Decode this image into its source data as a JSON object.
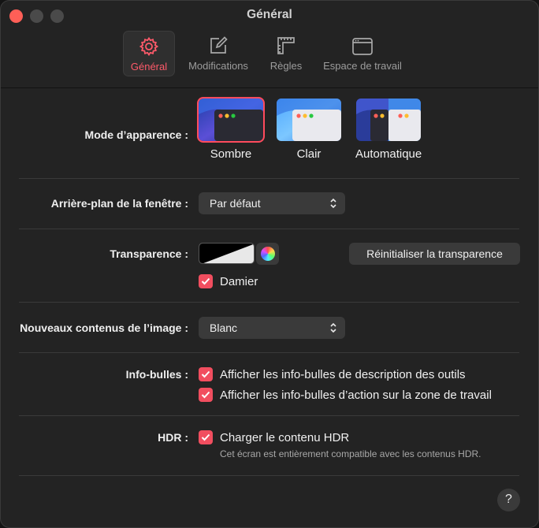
{
  "window": {
    "title": "Général"
  },
  "tabs": [
    {
      "label": "Général",
      "icon": "gear-icon",
      "active": true
    },
    {
      "label": "Modifications",
      "icon": "edit-icon",
      "active": false
    },
    {
      "label": "Règles",
      "icon": "ruler-icon",
      "active": false
    },
    {
      "label": "Espace de travail",
      "icon": "window-icon",
      "active": false
    }
  ],
  "appearance": {
    "label": "Mode d’apparence :",
    "options": [
      {
        "label": "Sombre",
        "selected": true
      },
      {
        "label": "Clair",
        "selected": false
      },
      {
        "label": "Automatique",
        "selected": false
      }
    ]
  },
  "background": {
    "label": "Arrière-plan de la fenêtre :",
    "value": "Par défaut"
  },
  "transparency": {
    "label": "Transparence :",
    "reset_button": "Réinitialiser la transparence",
    "checkerboard": {
      "label": "Damier",
      "checked": true
    }
  },
  "new_content": {
    "label": "Nouveaux contenus de l’image :",
    "value": "Blanc"
  },
  "tooltips": {
    "label": "Info-bulles :",
    "options": [
      {
        "label": "Afficher les info-bulles de description des outils",
        "checked": true
      },
      {
        "label": "Afficher les info-bulles d’action sur la zone de travail",
        "checked": true
      }
    ]
  },
  "hdr": {
    "label": "HDR :",
    "option": {
      "label": "Charger le contenu HDR",
      "checked": true
    },
    "note": "Cet écran est entièrement compatible avec les contenus HDR."
  },
  "help": {
    "label": "?"
  },
  "colors": {
    "accent": "#ff4b5c",
    "checkbox": "#f14e5f",
    "window_bg": "#232323",
    "control_bg": "#3a3a3a"
  }
}
